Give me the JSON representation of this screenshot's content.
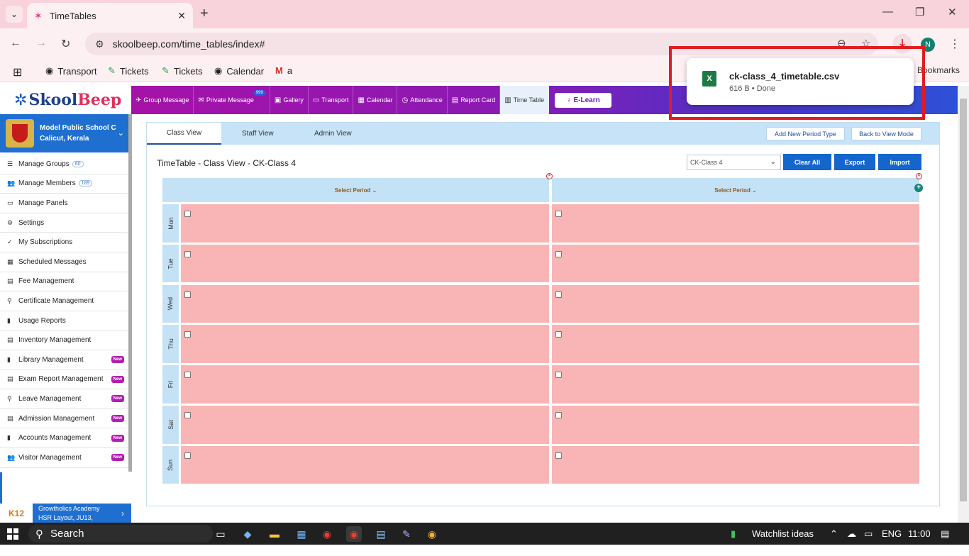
{
  "browser": {
    "tab_title": "TimeTables",
    "url": "skoolbeep.com/time_tables/index#",
    "bookmarks": [
      "Transport",
      "Tickets",
      "Tickets",
      "Calendar",
      "a"
    ],
    "all_bookmarks": "Bookmarks",
    "profile_initial": "N"
  },
  "download": {
    "filename": "ck-class_4_timetable.csv",
    "status": "616 B • Done"
  },
  "app": {
    "logo_skool": "Skool",
    "logo_beep": "Beep",
    "nav": [
      {
        "label": "Group Message",
        "icon": "✈"
      },
      {
        "label": "Private Message",
        "icon": "✉",
        "badge": "999"
      },
      {
        "label": "Gallery",
        "icon": "▣"
      },
      {
        "label": "Transport",
        "icon": "▭"
      },
      {
        "label": "Calendar",
        "icon": "▦"
      },
      {
        "label": "Attendance",
        "icon": "◷"
      },
      {
        "label": "Report Card",
        "icon": "▤"
      },
      {
        "label": "Time Table",
        "icon": "▥"
      }
    ],
    "elearn": "E-Learn"
  },
  "school": {
    "name": "Model Public School C",
    "location": "Calicut, Kerala"
  },
  "sidebar": {
    "items": [
      {
        "label": "Manage Groups",
        "icon": "☰",
        "count": "60"
      },
      {
        "label": "Manage Members",
        "icon": "👥",
        "count": "189"
      },
      {
        "label": "Manage Panels",
        "icon": "▭"
      },
      {
        "label": "Settings",
        "icon": "⚙"
      },
      {
        "label": "My Subscriptions",
        "icon": "✓"
      },
      {
        "label": "Scheduled Messages",
        "icon": "▦"
      },
      {
        "label": "Fee Management",
        "icon": "▤"
      },
      {
        "label": "Certificate Management",
        "icon": "⚲"
      },
      {
        "label": "Usage Reports",
        "icon": "▮"
      },
      {
        "label": "Inventory Management",
        "icon": "▤"
      },
      {
        "label": "Library Management",
        "icon": "▮",
        "new": "New"
      },
      {
        "label": "Exam Report Management",
        "icon": "▤",
        "new": "New"
      },
      {
        "label": "Leave Management",
        "icon": "⚲",
        "new": "New"
      },
      {
        "label": "Admission Management",
        "icon": "▤",
        "new": "New"
      },
      {
        "label": "Accounts Management",
        "icon": "▮",
        "new": "New"
      },
      {
        "label": "Visitor Management",
        "icon": "👥",
        "new": "New"
      }
    ],
    "org": {
      "logo": "K12",
      "name": "Growtholics Academy",
      "address": "HSR Layout, JU13,"
    }
  },
  "timetable": {
    "tabs": [
      "Class View",
      "Staff View",
      "Admin View"
    ],
    "add_period_type": "Add New Period Type",
    "back_to_view": "Back to View Mode",
    "title": "TimeTable - Class View - CK-Class 4",
    "selected_class": "CK-Class 4",
    "clear_all": "Clear All",
    "export": "Export",
    "import": "Import",
    "column_header": "Select Period",
    "days": [
      "Mon",
      "Tue",
      "Wed",
      "Thu",
      "Fri",
      "Sat",
      "Sun"
    ]
  },
  "taskbar": {
    "search": "Search",
    "watchlist": "Watchlist ideas",
    "lang": "ENG",
    "time": "11:00"
  },
  "colors": {
    "cell": "#f9b5b5",
    "header_blue": "#c4e2f5",
    "accent": "#1466cc"
  }
}
